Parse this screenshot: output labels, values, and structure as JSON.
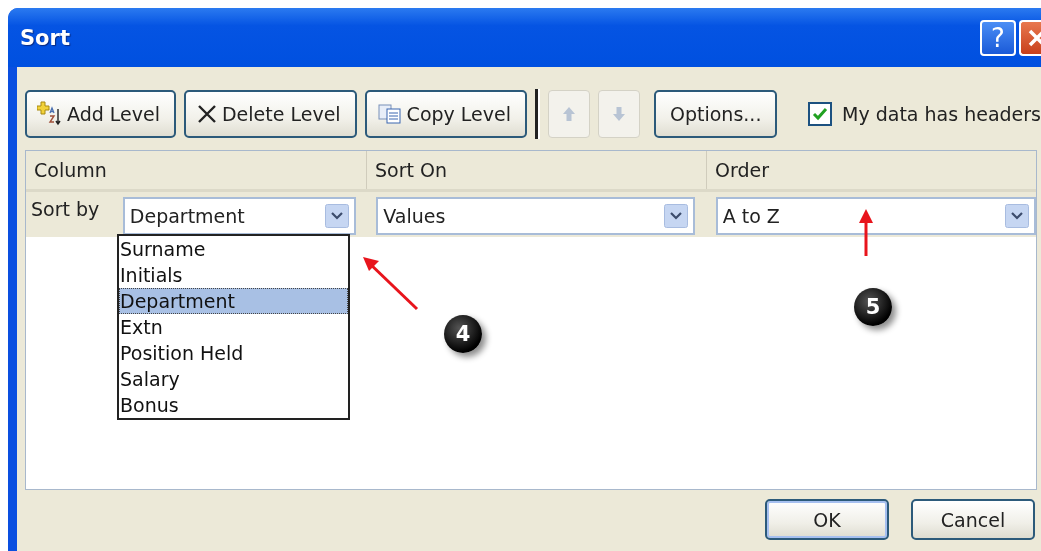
{
  "window": {
    "title": "Sort",
    "title_buttons": [
      {
        "kind": "help",
        "label": "?"
      },
      {
        "kind": "close"
      }
    ]
  },
  "toolbar": {
    "buttons": [
      {
        "kind": "add",
        "label": "Add Level",
        "disabled": false
      },
      {
        "kind": "delete",
        "label": "Delete Level",
        "disabled": false
      },
      {
        "kind": "copy",
        "label": "Copy Level",
        "disabled": false
      },
      {
        "kind": "up",
        "disabled": true
      },
      {
        "kind": "down",
        "disabled": true
      },
      {
        "kind": "text",
        "label": "Options...",
        "disabled": false
      }
    ],
    "headers_checkbox": {
      "label": "My data has headers",
      "checked": true
    }
  },
  "table": {
    "columns": [
      "Column",
      "Sort On",
      "Order"
    ],
    "rows": [
      {
        "label": "Sort by",
        "column": "Department",
        "sort_on": "Values",
        "order": "A to Z"
      }
    ]
  },
  "dropdown": {
    "items": [
      {
        "label": "Surname",
        "selected": false
      },
      {
        "label": "Initials",
        "selected": false
      },
      {
        "label": "Department",
        "selected": true
      },
      {
        "label": "Extn",
        "selected": false
      },
      {
        "label": "Position Held",
        "selected": false
      },
      {
        "label": "Salary",
        "selected": false
      },
      {
        "label": "Bonus",
        "selected": false
      }
    ]
  },
  "annotations": [
    {
      "label": "4",
      "kind": "diagonal"
    },
    {
      "label": "5",
      "kind": "vertical"
    }
  ],
  "buttons": [
    {
      "label": "OK",
      "default": true
    },
    {
      "label": "Cancel",
      "default": false
    }
  ]
}
